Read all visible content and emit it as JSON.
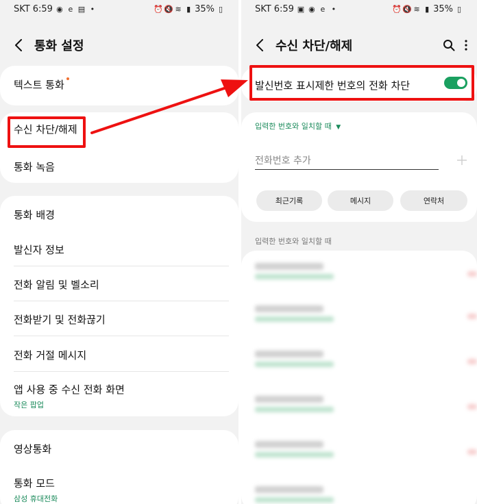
{
  "status": {
    "carrier": "SKT",
    "time": "6:59",
    "battery": "35%"
  },
  "left_screen": {
    "title": "통화 설정",
    "items": [
      {
        "label": "텍스트 통화"
      },
      {
        "label": "수신 차단/해제"
      },
      {
        "label": "통화 녹음"
      },
      {
        "label": "통화 배경"
      },
      {
        "label": "발신자 정보"
      },
      {
        "label": "전화 알림 및 벨소리"
      },
      {
        "label": "전화받기 및 전화끊기"
      },
      {
        "label": "전화 거절 메시지"
      },
      {
        "label": "앱 사용 중 수신 전화 화면",
        "sub": "작은 팝업"
      },
      {
        "label": "영상통화"
      },
      {
        "label": "통화 모드",
        "sub": "삼성 휴대전화"
      }
    ]
  },
  "right_screen": {
    "title": "수신 차단/해제",
    "toggle_label": "발신번호 표시제한 번호의 전화 차단",
    "toggle_on": true,
    "match_dropdown": "입력한 번호와 일치할 때",
    "phone_placeholder": "전화번호 추가",
    "buttons": {
      "recent": "최근기록",
      "messages": "메시지",
      "contacts": "연락처"
    },
    "list_header": "입력한 번호와 일치할 때"
  },
  "colors": {
    "highlight": "#ee1111",
    "accent_green": "#1aa060",
    "badge_orange": "#f07030"
  }
}
